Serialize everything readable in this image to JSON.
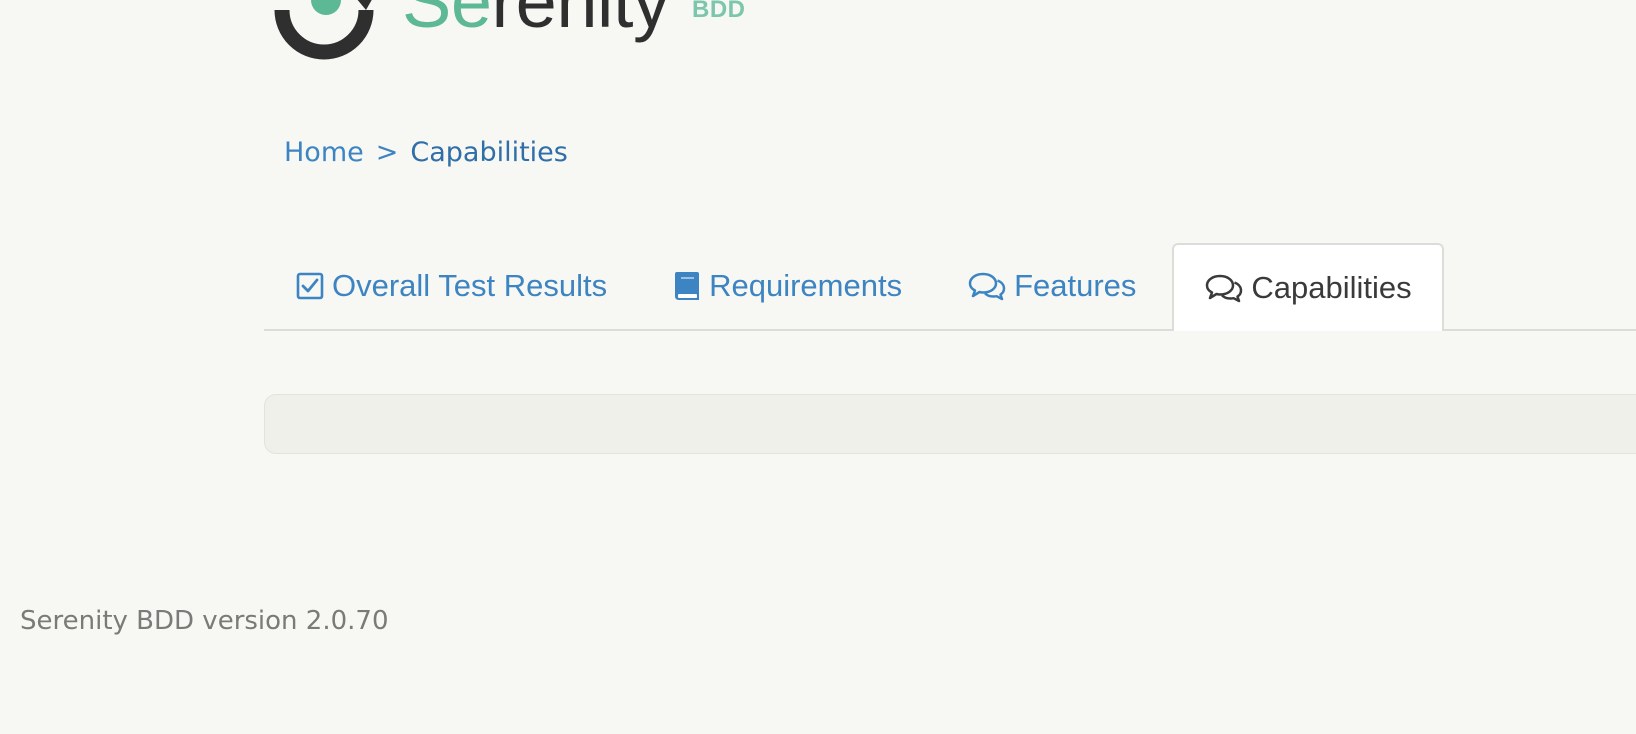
{
  "logo": {
    "text_accent": "Se",
    "text_rest": "renity",
    "badge": "BDD"
  },
  "breadcrumb": {
    "home": "Home",
    "separator": ">",
    "current": "Capabilities"
  },
  "tabs": [
    {
      "label": "Overall Test Results",
      "icon": "checkbox-icon",
      "active": false
    },
    {
      "label": "Requirements",
      "icon": "book-icon",
      "active": false
    },
    {
      "label": "Features",
      "icon": "comments-icon",
      "active": false
    },
    {
      "label": "Capabilities",
      "icon": "comments-icon",
      "active": true
    }
  ],
  "footer": {
    "version_text": "Serenity BDD version 2.0.70"
  },
  "colors": {
    "background": "#f7f7f3",
    "link": "#3d84c2",
    "brand_green": "#5cb895",
    "active_tab_text": "#3a3a3a",
    "footer_text": "#7a7a78"
  }
}
